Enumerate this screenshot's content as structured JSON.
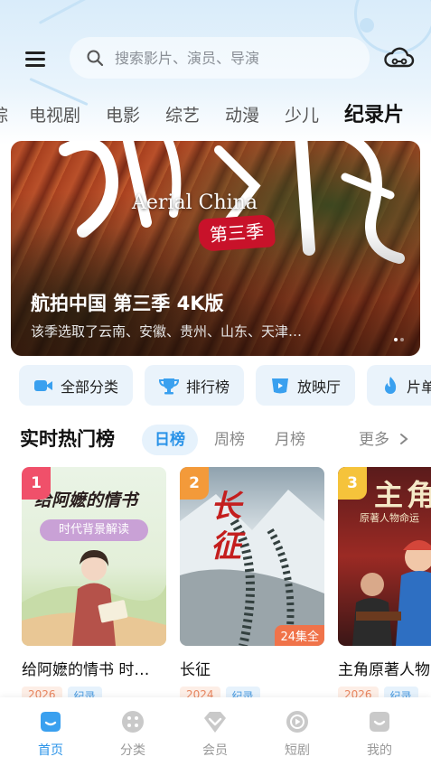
{
  "header": {
    "search_placeholder": "搜索影片、演员、导演"
  },
  "tabs": [
    {
      "label": "综"
    },
    {
      "label": "电视剧"
    },
    {
      "label": "电影"
    },
    {
      "label": "综艺"
    },
    {
      "label": "动漫"
    },
    {
      "label": "少儿"
    },
    {
      "label": "纪录片",
      "active": true
    }
  ],
  "banner": {
    "title": "航拍中国 第三季 4K版",
    "subtitle_en": "Aerial China",
    "seal_text": "第三季",
    "description": "该季选取了云南、安徽、贵州、山东、天津…",
    "page_count": 2,
    "current_page": 1
  },
  "quick_links": [
    {
      "label": "全部分类",
      "icon": "video-camera-icon"
    },
    {
      "label": "排行榜",
      "icon": "trophy-icon"
    },
    {
      "label": "放映厅",
      "icon": "cinema-screen-icon"
    },
    {
      "label": "片单",
      "icon": "flame-icon"
    }
  ],
  "ranking": {
    "title": "实时热门榜",
    "periods": [
      {
        "label": "日榜",
        "active": true
      },
      {
        "label": "周榜"
      },
      {
        "label": "月榜"
      }
    ],
    "more_label": "更多",
    "items": [
      {
        "rank": "1",
        "rank_color": "#f0506a",
        "title": "给阿嬷的情书 时…",
        "poster_title": "给阿嬷的情书",
        "poster_subtitle": "时代背景解读",
        "year": "2026",
        "genre": "纪录"
      },
      {
        "rank": "2",
        "rank_color": "#f39a3a",
        "title": "长征",
        "poster_title": "长征",
        "episodes": "24集全",
        "year": "2024",
        "genre": "纪录"
      },
      {
        "rank": "3",
        "rank_color": "#f5c33b",
        "title": "主角原著人物",
        "poster_title": "主角",
        "poster_subtitle": "原著人物命运",
        "year": "2026",
        "genre": "纪录"
      }
    ]
  },
  "bottom_nav": [
    {
      "label": "首页",
      "icon": "home-icon",
      "active": true
    },
    {
      "label": "分类",
      "icon": "category-icon"
    },
    {
      "label": "会员",
      "icon": "vip-diamond-icon"
    },
    {
      "label": "短剧",
      "icon": "play-circle-icon"
    },
    {
      "label": "我的",
      "icon": "profile-icon"
    }
  ],
  "colors": {
    "accent": "#2a93e8",
    "header_bg": "#d9ecfa",
    "chip_bg": "#eaf3fb"
  }
}
